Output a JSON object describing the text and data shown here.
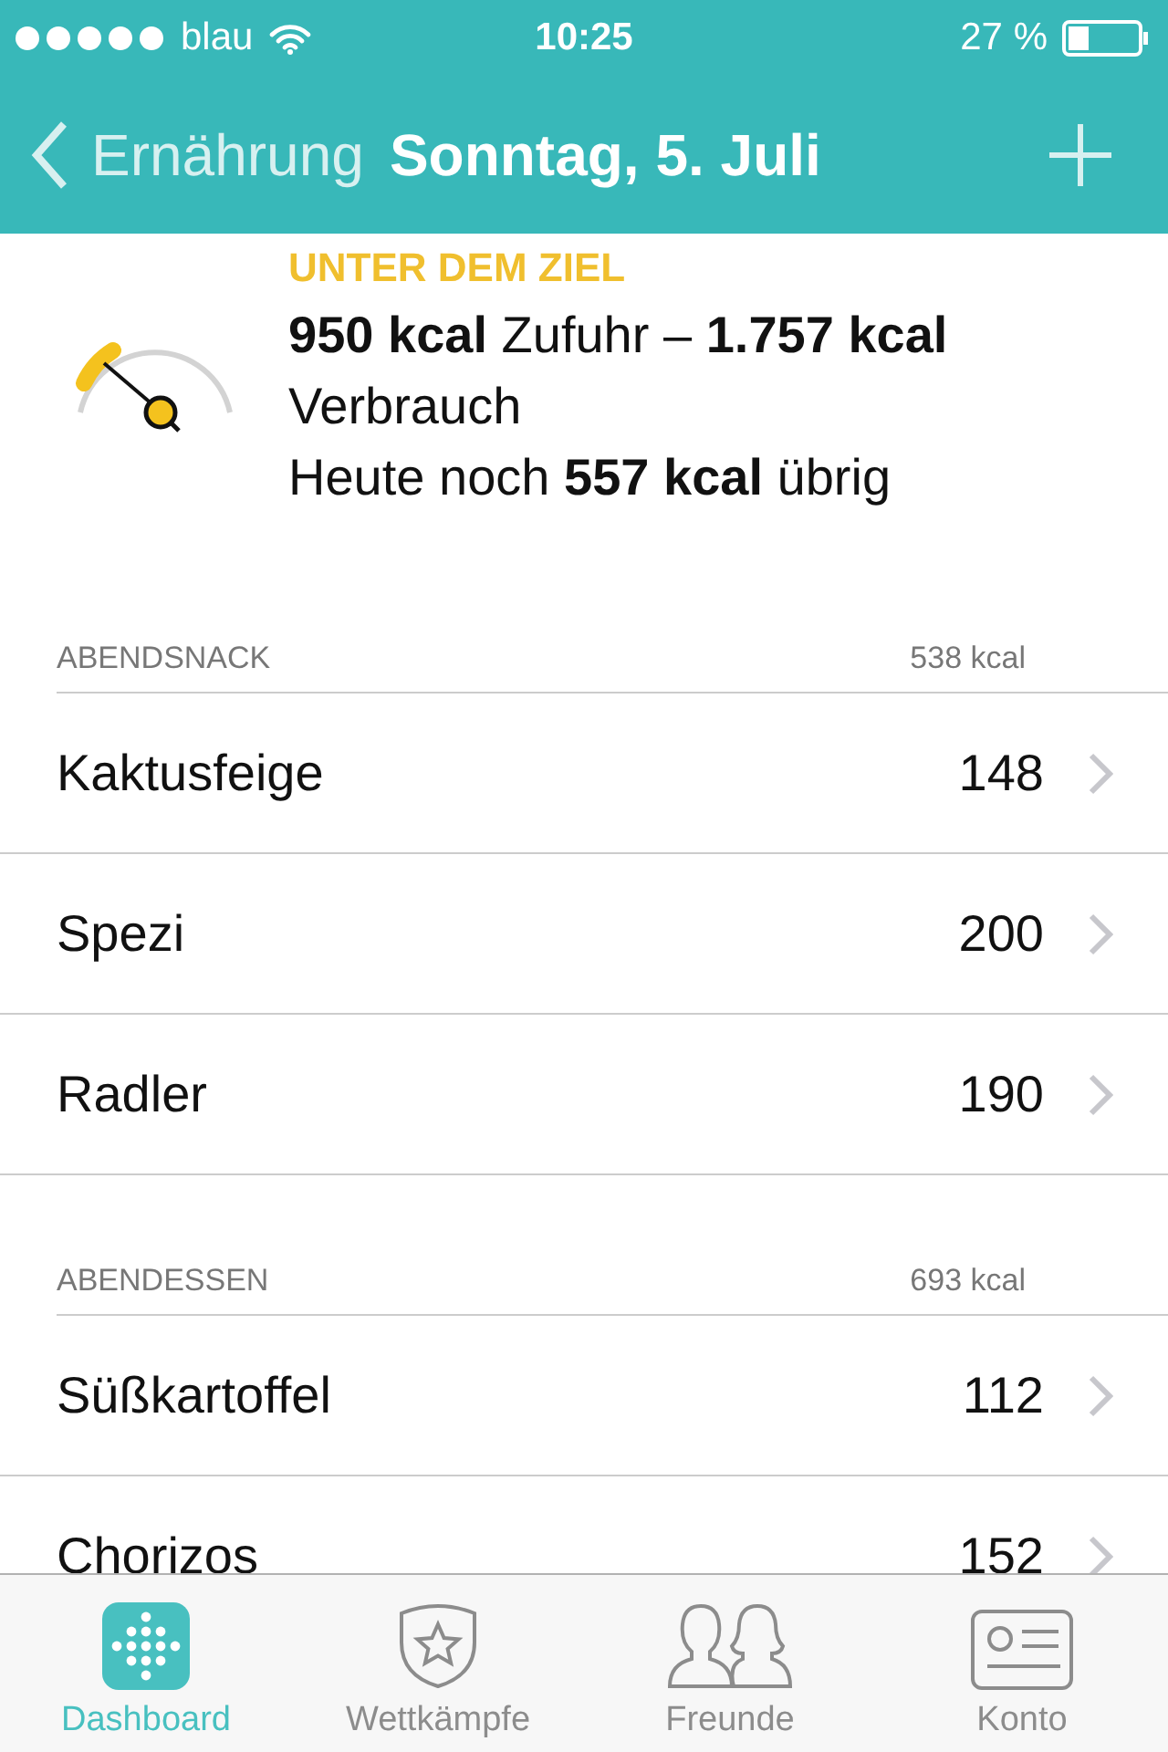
{
  "status_bar": {
    "carrier": "blau",
    "time": "10:25",
    "battery": "27 %"
  },
  "nav": {
    "back": "Ernährung",
    "title": "Sonntag, 5. Juli"
  },
  "summary": {
    "status": "UNTER DEM ZIEL",
    "line1": "**950 kcal** Zufuhr – **1.757 kcal** Verbrauch",
    "line2": "Heute noch **557 kcal** übrig"
  },
  "sections": [
    {
      "title": "ABENDSNACK",
      "total": "538 kcal",
      "items": [
        {
          "name": "Kaktusfeige",
          "value": "148"
        },
        {
          "name": "Spezi",
          "value": "200"
        },
        {
          "name": "Radler",
          "value": "190"
        }
      ]
    },
    {
      "title": "ABENDESSEN",
      "total": "693 kcal",
      "items": [
        {
          "name": "Süßkartoffel",
          "value": "112"
        },
        {
          "name": "Chorizos",
          "value": "152"
        }
      ]
    }
  ],
  "tabs": [
    {
      "label": "Dashboard",
      "kind": "dashboard",
      "selected": true
    },
    {
      "label": "Wettkämpfe",
      "kind": "challenges",
      "selected": false
    },
    {
      "label": "Freunde",
      "kind": "friends",
      "selected": false
    },
    {
      "label": "Konto",
      "kind": "account",
      "selected": false
    }
  ]
}
